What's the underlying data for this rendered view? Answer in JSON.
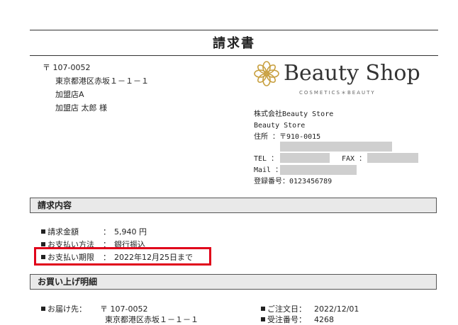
{
  "document": {
    "title": "請求書"
  },
  "recipient": {
    "postal": "〒 107-0052",
    "address": "東京都港区赤坂１－１－１",
    "store": "加盟店A",
    "name": "加盟店 太郎 様"
  },
  "brand": {
    "logo_text": "Beauty Shop",
    "tagline": "COSMETICS＊BEAUTY",
    "accent_color": "#c8a040"
  },
  "sender": {
    "company": "株式会社Beauty Store",
    "store": "Beauty Store",
    "address_label": "住所 ：〒910-0015",
    "tel_label": "TEL  ：",
    "fax_label": "FAX ：",
    "mail_label": "Mail ：",
    "registration": "登録番号：0123456789"
  },
  "billing": {
    "section_title": "請求内容",
    "amount_label": "請求金額",
    "amount_sep": "：",
    "amount_value": "5,940 円",
    "method_label": "お支払い方法",
    "method_sep": "：",
    "method_value": "銀行振込",
    "deadline_label": "お支払い期限",
    "deadline_sep": "：",
    "deadline_value": "2022年12月25日まで"
  },
  "purchase": {
    "section_title": "お買い上げ明細",
    "ship_label": "お届け先：",
    "ship_postal": "〒 107-0052",
    "ship_address": "東京都港区赤坂１－１－１",
    "order_date_label": "ご注文日：",
    "order_date_value": "2022/12/01",
    "order_no_label": "受注番号：",
    "order_no_value": "4268"
  }
}
